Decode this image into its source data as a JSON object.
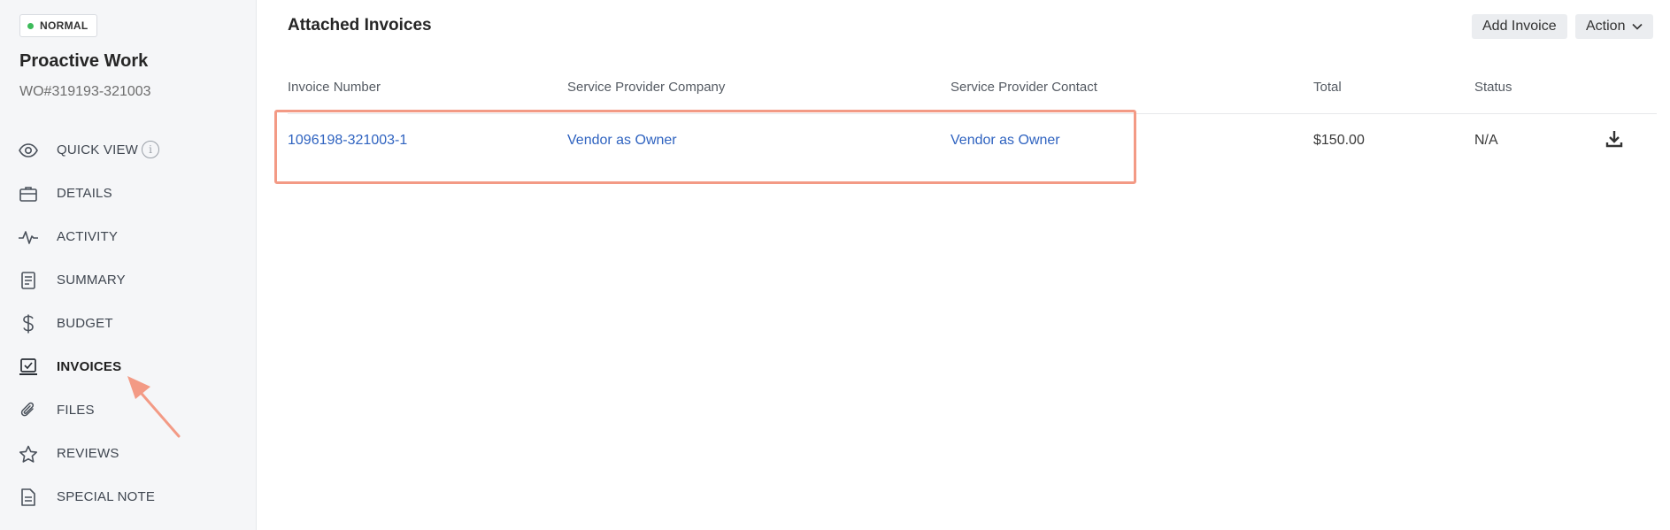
{
  "sidebar": {
    "priority_badge": "NORMAL",
    "title": "Proactive Work",
    "wo_number": "WO#319193-321003",
    "items": [
      {
        "label": "QUICK VIEW",
        "icon": "eye-icon"
      },
      {
        "label": "DETAILS",
        "icon": "briefcase-icon"
      },
      {
        "label": "ACTIVITY",
        "icon": "pulse-icon"
      },
      {
        "label": "SUMMARY",
        "icon": "document-icon"
      },
      {
        "label": "BUDGET",
        "icon": "dollar-icon"
      },
      {
        "label": "INVOICES",
        "icon": "invoice-icon",
        "active": true
      },
      {
        "label": "FILES",
        "icon": "paperclip-icon"
      },
      {
        "label": "REVIEWS",
        "icon": "star-icon"
      },
      {
        "label": "SPECIAL NOTE",
        "icon": "note-icon"
      }
    ]
  },
  "main": {
    "title": "Attached Invoices",
    "add_invoice_label": "Add Invoice",
    "action_label": "Action",
    "table": {
      "columns": [
        "Invoice Number",
        "Service Provider Company",
        "Service Provider Contact",
        "Total",
        "Status"
      ],
      "rows": [
        {
          "invoice_number": "1096198-321003-1",
          "company": "Vendor as Owner",
          "contact": "Vendor as Owner",
          "total": "$150.00",
          "status": "N/A"
        }
      ]
    }
  },
  "colors": {
    "accent_link": "#2f63c0",
    "highlight": "#f39a85",
    "status_dot": "#3dbb5a",
    "sidebar_bg": "#f5f6f8"
  }
}
